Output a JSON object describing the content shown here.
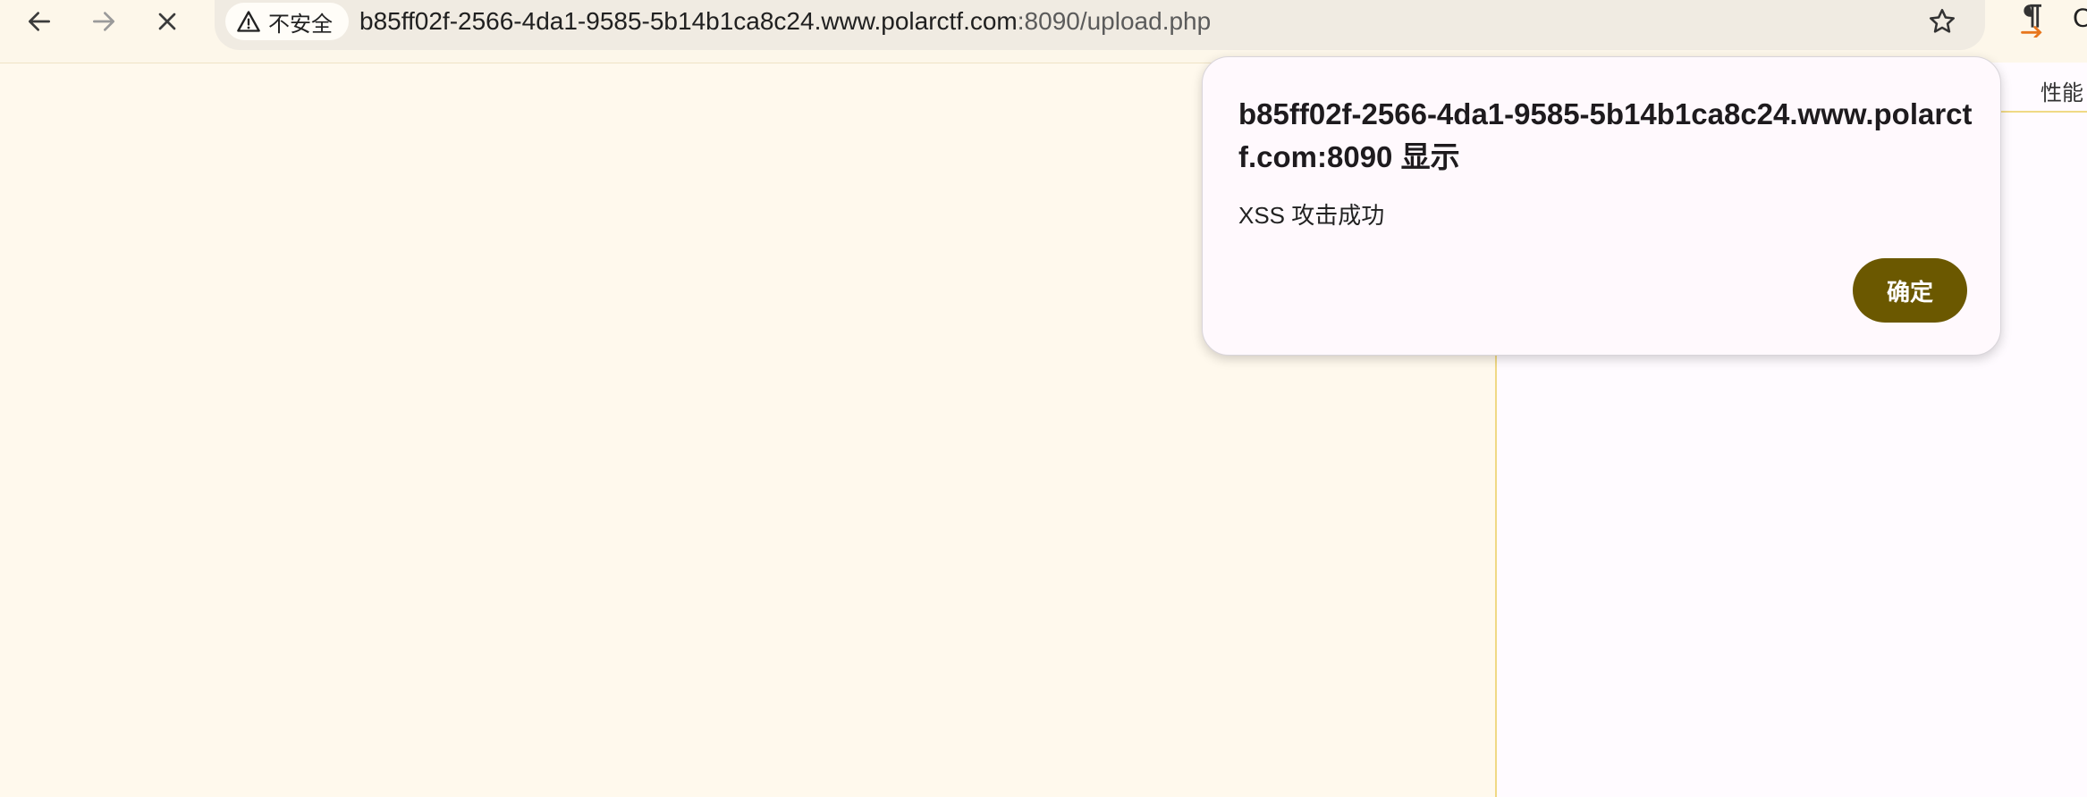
{
  "browser": {
    "security_label": "不安全",
    "url_host": "b85ff02f-2566-4da1-9585-5b14b1ca8c24.www.polarctf.com",
    "url_path": ":8090/upload.php",
    "icons": {
      "back": "arrow-left-icon",
      "forward": "arrow-right-icon",
      "stop": "close-icon",
      "security": "warning-triangle-icon",
      "bookmark": "star-icon",
      "extension": "pilcrow-icon"
    },
    "edge_char": "C"
  },
  "devtools": {
    "visible_tab": "性能"
  },
  "dialog": {
    "title": "b85ff02f-2566-4da1-9585-5b14b1ca8c24.www.polarctf.com:8090 显示",
    "message": "XSS 攻击成功",
    "ok_label": "确定"
  },
  "colors": {
    "page_bg": "#fff9ed",
    "dialog_bg": "#fff9fd",
    "ok_button": "#6b5800",
    "devtools_border": "#f0d985"
  }
}
